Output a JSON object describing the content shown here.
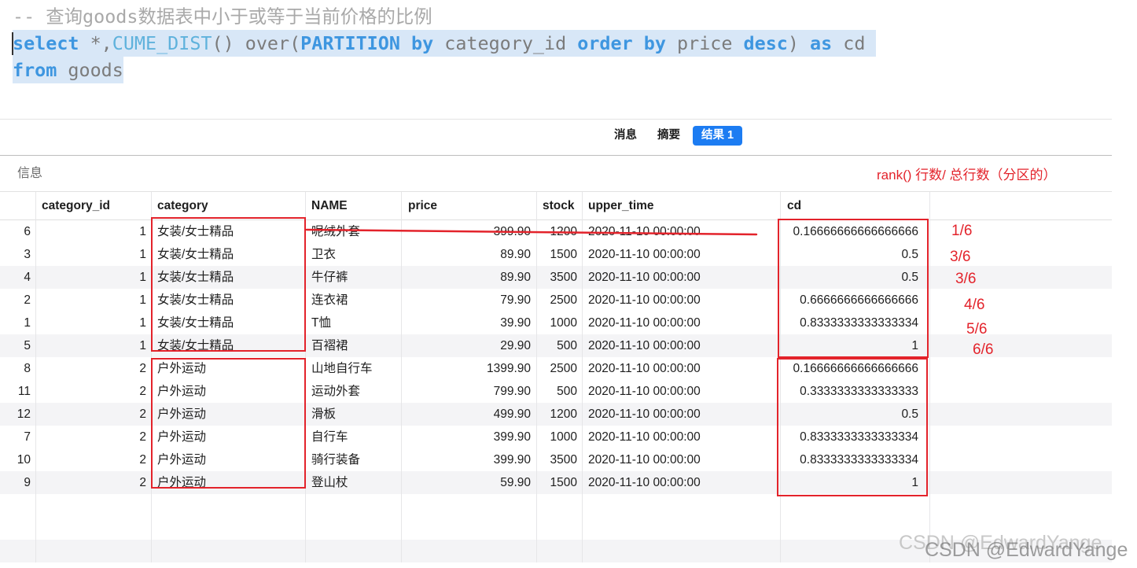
{
  "editor": {
    "selected_lines": [
      1,
      2
    ],
    "lines": [
      [
        {
          "t": "-- 查询goods数据表中小于或等于当前价格的比例",
          "k": "comment"
        }
      ],
      [
        {
          "t": "select",
          "k": "kw"
        },
        {
          "t": " *,",
          "k": "plain"
        },
        {
          "t": "CUME_DIST",
          "k": "func"
        },
        {
          "t": "() over(",
          "k": "plain"
        },
        {
          "t": "PARTITION",
          "k": "kw"
        },
        {
          "t": " ",
          "k": "plain"
        },
        {
          "t": "by",
          "k": "kw"
        },
        {
          "t": " category_id ",
          "k": "plain"
        },
        {
          "t": "order",
          "k": "kw"
        },
        {
          "t": " ",
          "k": "plain"
        },
        {
          "t": "by",
          "k": "kw"
        },
        {
          "t": " price ",
          "k": "plain"
        },
        {
          "t": "desc",
          "k": "kw"
        },
        {
          "t": ") ",
          "k": "plain"
        },
        {
          "t": "as",
          "k": "kw"
        },
        {
          "t": " cd",
          "k": "plain"
        }
      ],
      [
        {
          "t": "from",
          "k": "kw"
        },
        {
          "t": " goods",
          "k": "plain"
        }
      ]
    ]
  },
  "result_tabs": {
    "items": [
      {
        "label": "消息"
      },
      {
        "label": "摘要"
      },
      {
        "label": "结果 1"
      }
    ],
    "active_index": 2
  },
  "info_label": "信息",
  "grid": {
    "columns": [
      "category_id",
      "category",
      "NAME",
      "price",
      "stock",
      "upper_time",
      "cd"
    ],
    "rows": [
      [
        "6",
        "1",
        "女装/女士精品",
        "呢绒外套",
        "399.90",
        "1200",
        "2020-11-10 00:00:00",
        "0.16666666666666666"
      ],
      [
        "3",
        "1",
        "女装/女士精品",
        "卫衣",
        "89.90",
        "1500",
        "2020-11-10 00:00:00",
        "0.5"
      ],
      [
        "4",
        "1",
        "女装/女士精品",
        "牛仔裤",
        "89.90",
        "3500",
        "2020-11-10 00:00:00",
        "0.5"
      ],
      [
        "2",
        "1",
        "女装/女士精品",
        "连衣裙",
        "79.90",
        "2500",
        "2020-11-10 00:00:00",
        "0.6666666666666666"
      ],
      [
        "1",
        "1",
        "女装/女士精品",
        "T恤",
        "39.90",
        "1000",
        "2020-11-10 00:00:00",
        "0.8333333333333334"
      ],
      [
        "5",
        "1",
        "女装/女士精品",
        "百褶裙",
        "29.90",
        "500",
        "2020-11-10 00:00:00",
        "1"
      ],
      [
        "8",
        "2",
        "户外运动",
        "山地自行车",
        "1399.90",
        "2500",
        "2020-11-10 00:00:00",
        "0.16666666666666666"
      ],
      [
        "11",
        "2",
        "户外运动",
        "运动外套",
        "799.90",
        "500",
        "2020-11-10 00:00:00",
        "0.3333333333333333"
      ],
      [
        "12",
        "2",
        "户外运动",
        "滑板",
        "499.90",
        "1200",
        "2020-11-10 00:00:00",
        "0.5"
      ],
      [
        "7",
        "2",
        "户外运动",
        "自行车",
        "399.90",
        "1000",
        "2020-11-10 00:00:00",
        "0.8333333333333334"
      ],
      [
        "10",
        "2",
        "户外运动",
        "骑行装备",
        "399.90",
        "3500",
        "2020-11-10 00:00:00",
        "0.8333333333333334"
      ],
      [
        "9",
        "2",
        "户外运动",
        "登山杖",
        "59.90",
        "1500",
        "2020-11-10 00:00:00",
        "1"
      ]
    ]
  },
  "annotations": {
    "note": "rank() 行数/ 总行数（分区的）",
    "fractions": [
      "1/6",
      "3/6",
      "3/6",
      "4/6",
      "5/6",
      "6/6"
    ]
  },
  "watermark": "CSDN @EdwardYange",
  "colors": {
    "accent": "#1c7cf2",
    "annotation_red": "#e3232b",
    "sql_keyword": "#3e96e0",
    "sql_function": "#5fb2dc",
    "selection": "#d8e7f7",
    "row_stripe": "#f4f4f6"
  }
}
